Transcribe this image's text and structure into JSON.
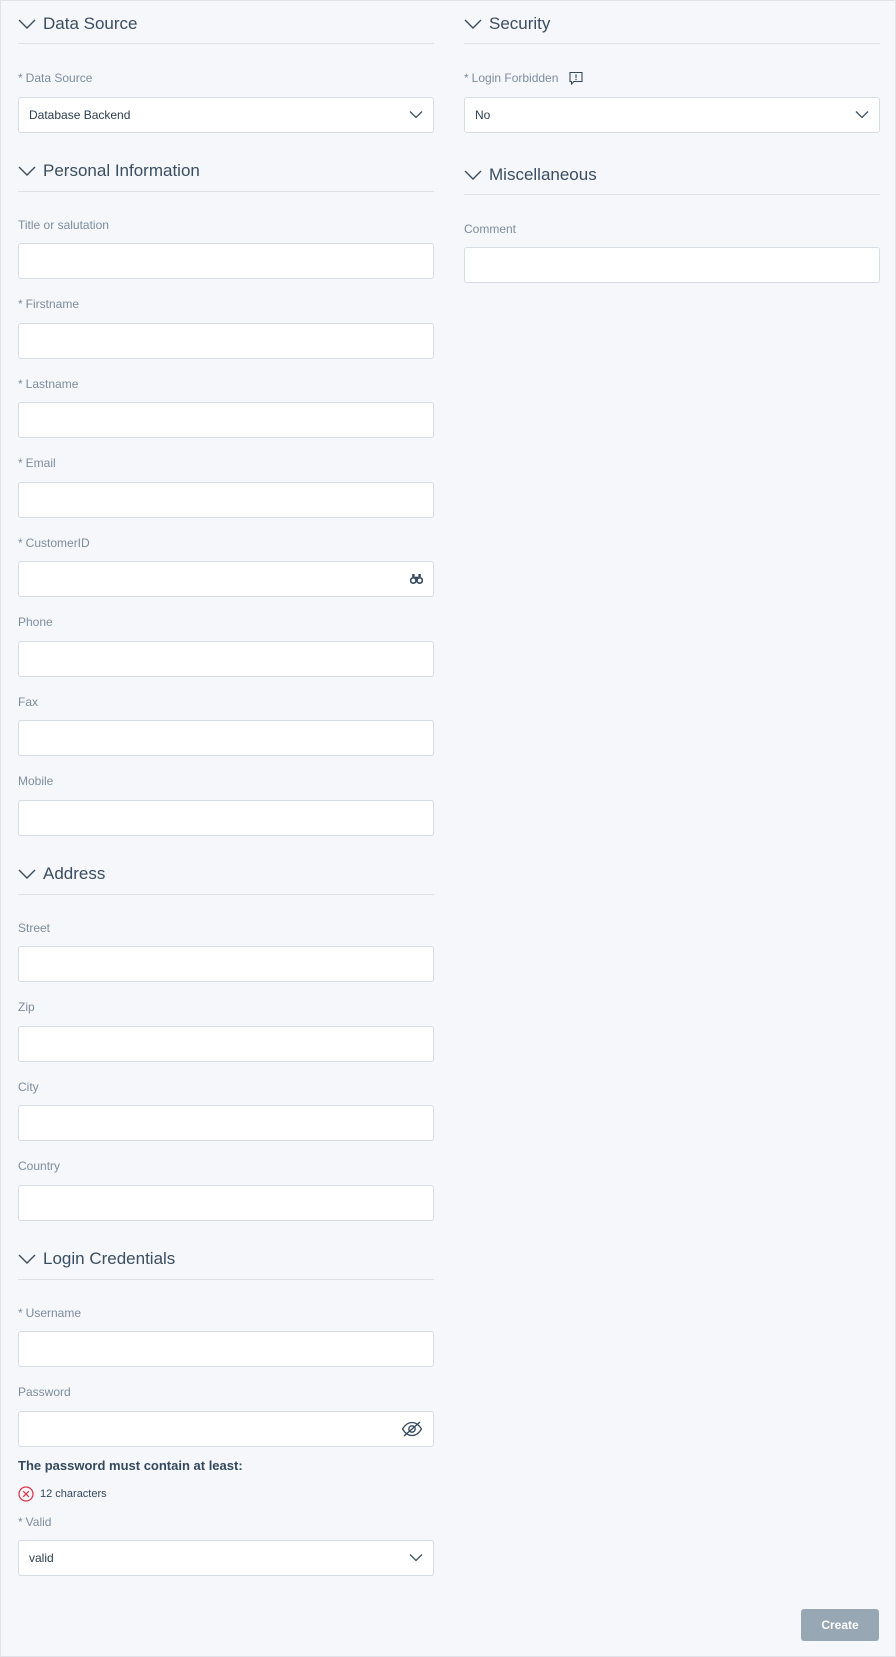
{
  "sections": {
    "data_source": {
      "title": "Data Source"
    },
    "personal_info": {
      "title": "Personal Information"
    },
    "address": {
      "title": "Address"
    },
    "login_credentials": {
      "title": "Login Credentials"
    },
    "security": {
      "title": "Security"
    },
    "miscellaneous": {
      "title": "Miscellaneous"
    }
  },
  "fields": {
    "data_source": {
      "label": "Data Source",
      "required": "*",
      "value": "Database Backend"
    },
    "title": {
      "label": "Title or salutation",
      "value": ""
    },
    "firstname": {
      "label": "Firstname",
      "required": "*",
      "value": ""
    },
    "lastname": {
      "label": "Lastname",
      "required": "*",
      "value": ""
    },
    "email": {
      "label": "Email",
      "required": "*",
      "value": ""
    },
    "customer_id": {
      "label": "CustomerID",
      "required": "*",
      "value": "",
      "icon": "binoculars-icon"
    },
    "phone": {
      "label": "Phone",
      "value": ""
    },
    "fax": {
      "label": "Fax",
      "value": ""
    },
    "mobile": {
      "label": "Mobile",
      "value": ""
    },
    "street": {
      "label": "Street",
      "value": ""
    },
    "zip": {
      "label": "Zip",
      "value": ""
    },
    "city": {
      "label": "City",
      "value": ""
    },
    "country": {
      "label": "Country",
      "value": ""
    },
    "username": {
      "label": "Username",
      "required": "*",
      "value": ""
    },
    "password": {
      "label": "Password",
      "value": "",
      "icon": "eye-slash-icon"
    },
    "valid": {
      "label": "Valid",
      "required": "*",
      "value": "valid"
    },
    "login_forbidden": {
      "label": "Login Forbidden",
      "required": "*",
      "value": "No",
      "icon": "tooltip-icon"
    },
    "comment": {
      "label": "Comment",
      "value": ""
    }
  },
  "password_hint": {
    "title": "The password must contain at least:",
    "rules": [
      {
        "text": "12 characters",
        "status": "error"
      }
    ]
  },
  "actions": {
    "create_label": "Create"
  },
  "colors": {
    "background": "#f5f7fb",
    "heading": "#3a4e60",
    "label": "#7d8d9c",
    "error": "#e0384b",
    "button_disabled": "#97a7b3"
  }
}
